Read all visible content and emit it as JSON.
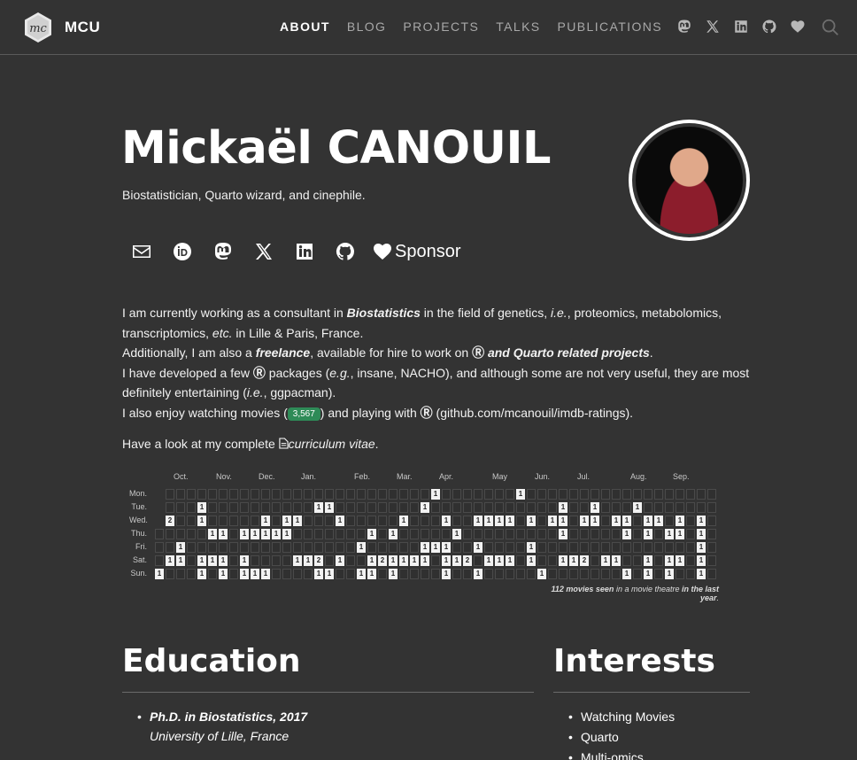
{
  "navbar": {
    "brand": "MCU",
    "links": [
      "ABOUT",
      "BLOG",
      "PROJECTS",
      "TALKS",
      "PUBLICATIONS"
    ]
  },
  "hero": {
    "name": "Mickaël CANOUIL",
    "subtitle": "Biostatistician, Quarto wizard, and cinephile.",
    "sponsor_label": "Sponsor"
  },
  "bio": {
    "l1a": "I am currently working as a consultant in ",
    "l1b": "Biostatistics",
    "l1c": " in the field of genetics, ",
    "l1d": "i.e.",
    "l1e": ", proteomics, metabolomics, transcriptomics, ",
    "l1f": "etc.",
    "l1g": " in Lille & Paris, France.",
    "l2a": "Additionally, I am also a ",
    "l2b": "freelance",
    "l2c": ", available for hire to work on ",
    "l2d": "and Quarto related projects",
    "l2e": ".",
    "l3a": "I have developed a few ",
    "l3b": " packages (",
    "l3c": "e.g.",
    "l3d": ", insane, NACHO), and although some are not very useful, they are most definitely entertaining (",
    "l3e": "i.e.",
    "l3f": ", ggpacman).",
    "l4a": "I also enjoy watching movies (",
    "movies_count": "3,567",
    "l4b": ") and playing with ",
    "l4c": " (github.com/mcanouil/imdb-ratings).",
    "cv_a": "Have a look at my complete ",
    "cv_b": "curriculum vitae",
    "cv_c": "."
  },
  "heatmap": {
    "months": [
      "Oct.",
      "Nov.",
      "Dec.",
      "Jan.",
      "Feb.",
      "Mar.",
      "Apr.",
      "May",
      "Jun.",
      "Jul.",
      "Aug.",
      "Sep."
    ],
    "days": [
      "Mon.",
      "Tue.",
      "Wed.",
      "Thu.",
      "Fri.",
      "Sat.",
      "Sun."
    ],
    "caption_a": "112 movies seen",
    "caption_b": " in a movie theatre ",
    "caption_c": "in the last year",
    "caption_d": "."
  },
  "education": {
    "title": "Education",
    "items": [
      {
        "degree": "Ph.D. in Biostatistics, 2017",
        "institution": "University of Lille, France"
      }
    ]
  },
  "interests": {
    "title": "Interests",
    "items": [
      "Watching Movies",
      "Quarto",
      "Multi-omics"
    ]
  }
}
